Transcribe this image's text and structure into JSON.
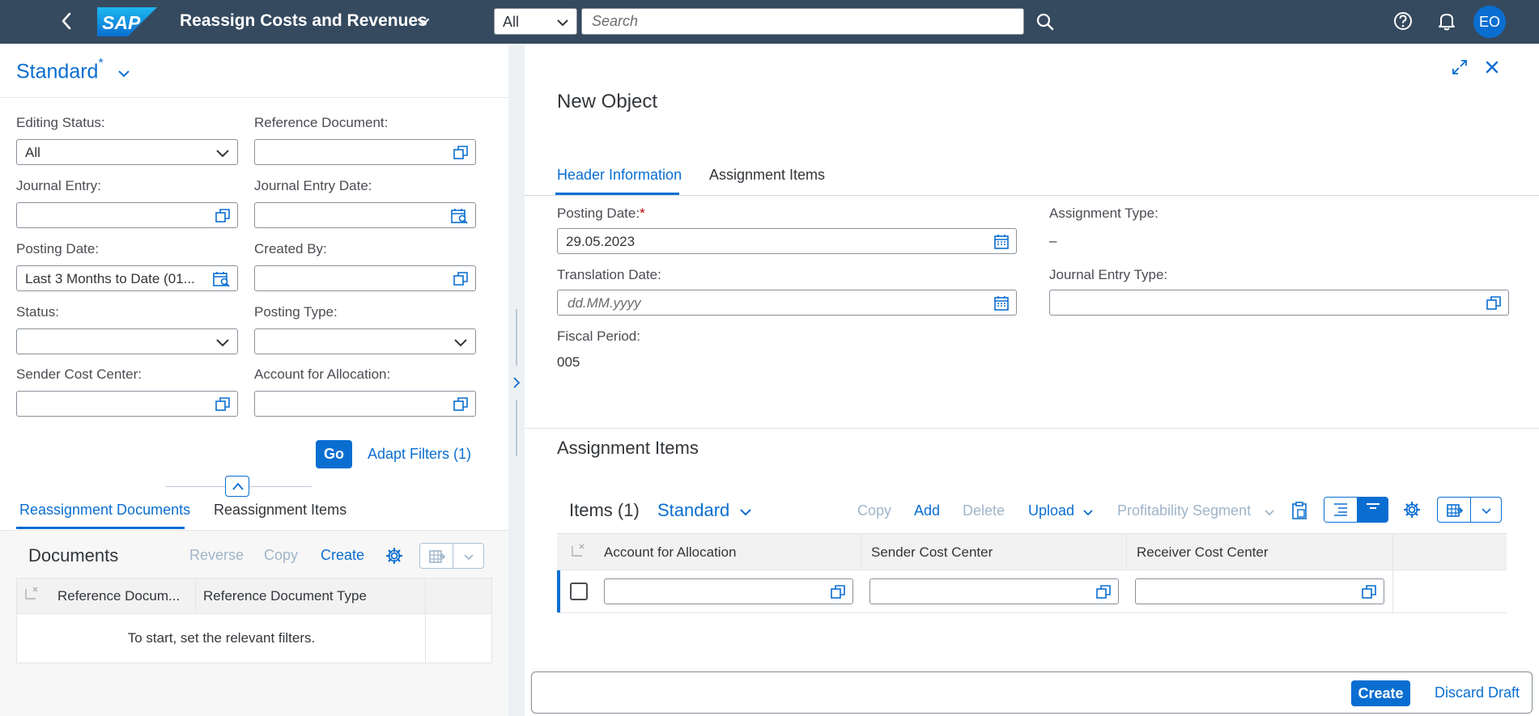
{
  "shell": {
    "app_title": "Reassign Costs and Revenues",
    "search_scope": "All",
    "search_placeholder": "Search",
    "avatar_initials": "EO"
  },
  "filter_bar": {
    "variant_name": "Standard",
    "variant_modified_marker": "*",
    "fields": {
      "editing_status": {
        "label": "Editing Status:",
        "value": "All"
      },
      "reference_document": {
        "label": "Reference Document:",
        "value": ""
      },
      "journal_entry": {
        "label": "Journal Entry:",
        "value": ""
      },
      "journal_entry_date": {
        "label": "Journal Entry Date:",
        "value": ""
      },
      "posting_date": {
        "label": "Posting Date:",
        "value": "Last 3 Months to Date (01..."
      },
      "created_by": {
        "label": "Created By:",
        "value": ""
      },
      "status": {
        "label": "Status:",
        "value": ""
      },
      "posting_type": {
        "label": "Posting Type:",
        "value": ""
      },
      "sender_cost_center": {
        "label": "Sender Cost Center:",
        "value": ""
      },
      "account_for_allocation": {
        "label": "Account for Allocation:",
        "value": ""
      }
    },
    "go_label": "Go",
    "adapt_filters_label": "Adapt Filters (1)"
  },
  "left_tabs": [
    "Reassignment Documents",
    "Reassignment Items"
  ],
  "documents": {
    "title": "Documents",
    "reverse_label": "Reverse",
    "copy_label": "Copy",
    "create_label": "Create",
    "columns": [
      "Reference Docum...",
      "Reference Document Type"
    ],
    "empty_text": "To start, set the relevant filters."
  },
  "object": {
    "title": "New Object",
    "tabs": [
      "Header Information",
      "Assignment Items"
    ],
    "fields": {
      "posting_date": {
        "label": "Posting Date:",
        "required_marker": "*",
        "value": "29.05.2023"
      },
      "assignment_type": {
        "label": "Assignment Type:",
        "value": "–"
      },
      "translation_date": {
        "label": "Translation Date:",
        "placeholder": "dd.MM.yyyy"
      },
      "journal_entry_type": {
        "label": "Journal Entry Type:",
        "value": ""
      },
      "fiscal_period": {
        "label": "Fiscal Period:",
        "value": "005"
      }
    }
  },
  "assignment_items": {
    "section_title": "Assignment Items",
    "table_title": "Items (1)",
    "variant": "Standard",
    "toolbar": {
      "copy": "Copy",
      "add": "Add",
      "delete": "Delete",
      "upload": "Upload",
      "profitability_segment": "Profitability Segment"
    },
    "columns": [
      "Account for Allocation",
      "Sender Cost Center",
      "Receiver Cost Center"
    ]
  },
  "footer": {
    "create_label": "Create",
    "discard_label": "Discard Draft"
  },
  "colors": {
    "shell_bg": "#354a5f",
    "brand_blue": "#0a6ed1",
    "disabled_text": "#9fb5ca",
    "required": "#bb0000"
  }
}
